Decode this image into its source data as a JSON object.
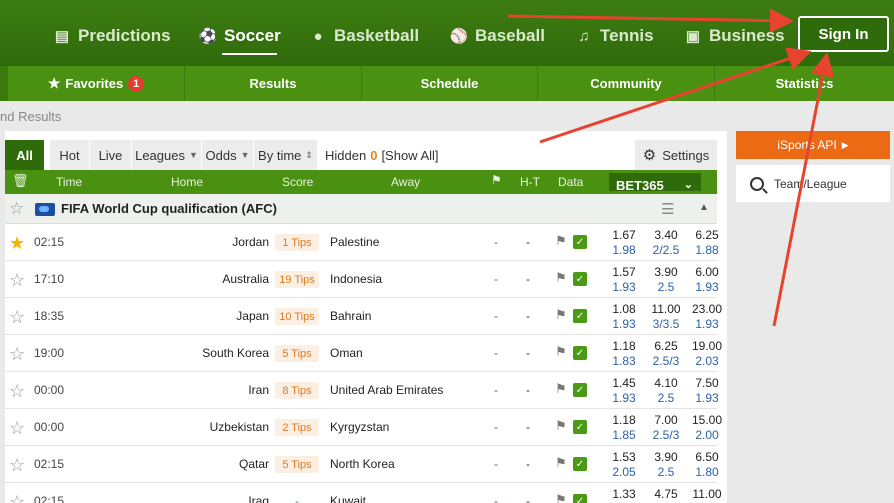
{
  "topnav": {
    "items": [
      {
        "label": "Predictions",
        "icon": "predictions-icon",
        "glyph": "▤"
      },
      {
        "label": "Soccer",
        "icon": "soccer-ball-icon",
        "glyph": "⚽",
        "active": true
      },
      {
        "label": "Basketball",
        "icon": "basketball-icon",
        "glyph": "●"
      },
      {
        "label": "Baseball",
        "icon": "baseball-bat-icon",
        "glyph": "⚾"
      },
      {
        "label": "Tennis",
        "icon": "tennis-racket-icon",
        "glyph": "♫"
      },
      {
        "label": "Business",
        "icon": "business-ad-icon",
        "glyph": "▣"
      }
    ],
    "signin_label": "Sign In"
  },
  "subnav": {
    "items": [
      {
        "label": "Favorites",
        "badge": "1"
      },
      {
        "label": "Results"
      },
      {
        "label": "Schedule"
      },
      {
        "label": "Community"
      },
      {
        "label": "Statistics"
      }
    ]
  },
  "breadcrumb": "nd Results",
  "filters": {
    "all": "All",
    "hot": "Hot",
    "live": "Live",
    "leagues": "Leagues",
    "odds": "Odds",
    "bytime": "By time",
    "hidden_label": "Hidden",
    "hidden_count": "0",
    "show_all": "[Show All]",
    "settings": "Settings"
  },
  "table_header": {
    "time": "Time",
    "home": "Home",
    "score": "Score",
    "away": "Away",
    "ht": "H-T",
    "data": "Data",
    "bookmaker": "BET365"
  },
  "league": {
    "name": "FIFA World Cup qualification (AFC)"
  },
  "matches": [
    {
      "fav": true,
      "time": "02:15",
      "home": "Jordan",
      "tips": "1 Tips",
      "away": "Palestine",
      "ht": "-",
      "score": "-",
      "odds": [
        [
          "1.67",
          "1.98"
        ],
        [
          "3.40",
          "2/2.5"
        ],
        [
          "6.25",
          "1.88"
        ]
      ]
    },
    {
      "fav": false,
      "time": "17:10",
      "home": "Australia",
      "tips": "19 Tips",
      "away": "Indonesia",
      "ht": "-",
      "score": "-",
      "odds": [
        [
          "1.57",
          "1.93"
        ],
        [
          "3.90",
          "2.5"
        ],
        [
          "6.00",
          "1.93"
        ]
      ]
    },
    {
      "fav": false,
      "time": "18:35",
      "home": "Japan",
      "tips": "10 Tips",
      "away": "Bahrain",
      "ht": "-",
      "score": "-",
      "odds": [
        [
          "1.08",
          "1.93"
        ],
        [
          "11.00",
          "3/3.5"
        ],
        [
          "23.00",
          "1.93"
        ]
      ]
    },
    {
      "fav": false,
      "time": "19:00",
      "home": "South Korea",
      "tips": "5 Tips",
      "away": "Oman",
      "ht": "-",
      "score": "-",
      "odds": [
        [
          "1.18",
          "1.83"
        ],
        [
          "6.25",
          "2.5/3"
        ],
        [
          "19.00",
          "2.03"
        ]
      ]
    },
    {
      "fav": false,
      "time": "00:00",
      "home": "Iran",
      "tips": "8 Tips",
      "away": "United Arab Emirates",
      "ht": "-",
      "score": "-",
      "odds": [
        [
          "1.45",
          "1.93"
        ],
        [
          "4.10",
          "2.5"
        ],
        [
          "7.50",
          "1.93"
        ]
      ]
    },
    {
      "fav": false,
      "time": "00:00",
      "home": "Uzbekistan",
      "tips": "2 Tips",
      "away": "Kyrgyzstan",
      "ht": "-",
      "score": "-",
      "odds": [
        [
          "1.18",
          "1.85"
        ],
        [
          "7.00",
          "2.5/3"
        ],
        [
          "15.00",
          "2.00"
        ]
      ]
    },
    {
      "fav": false,
      "time": "02:15",
      "home": "Qatar",
      "tips": "5 Tips",
      "away": "North Korea",
      "ht": "-",
      "score": "-",
      "odds": [
        [
          "1.53",
          "2.05"
        ],
        [
          "3.90",
          "2.5"
        ],
        [
          "6.50",
          "1.80"
        ]
      ]
    },
    {
      "fav": false,
      "time": "02:15",
      "home": "Iraq",
      "tips": "-",
      "away": "Kuwait",
      "ht": "-",
      "score": "-",
      "odds": [
        [
          "1.33",
          ""
        ],
        [
          "4.75",
          ""
        ],
        [
          "11.00",
          ""
        ]
      ]
    }
  ],
  "sidebar": {
    "api_label": "iSports API",
    "search_placeholder": "Team/League"
  },
  "colors": {
    "nav_dark": "#2f6a0b",
    "nav_green": "#4a9112",
    "accent_orange": "#ec6a14",
    "arrow_red": "#e8432e"
  }
}
